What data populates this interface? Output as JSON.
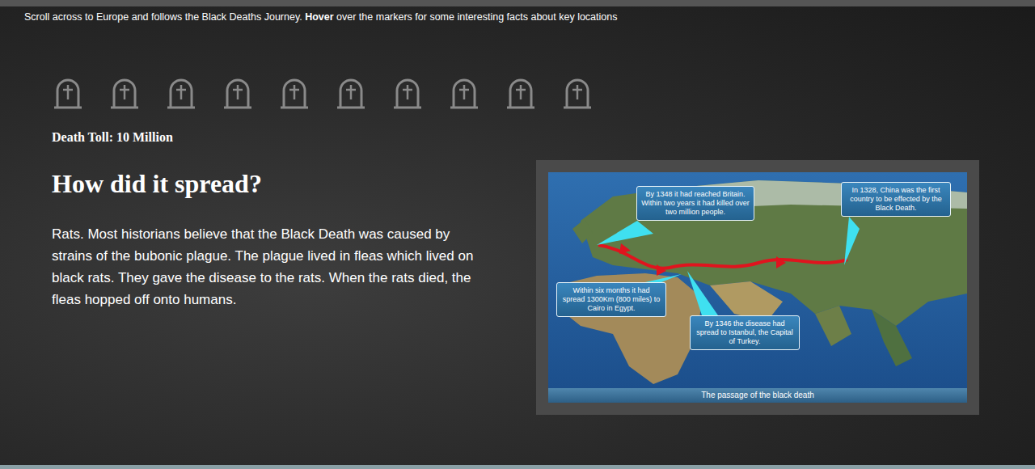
{
  "instruction": {
    "parts": [
      {
        "text": "Scroll across to Europe and follows the Black Deaths Journey. ",
        "bold": false
      },
      {
        "text": "Hover",
        "bold": true
      },
      {
        "text": " over the markers for some interesting facts about key locations",
        "bold": false
      }
    ]
  },
  "gravestone_count": 10,
  "death_toll": "Death Toll: 10 Million",
  "heading": "How did it spread?",
  "body": "Rats. Most historians believe that the Black Death was caused by strains of the bubonic plague. The plague lived in fleas which lived on black rats. They gave the disease to the rats. When the rats died, the fleas hopped off onto humans.",
  "map": {
    "callouts": [
      {
        "text": "By 1348 it had reached Britain. Within two years it had killed over two million people."
      },
      {
        "text": "In 1328, China was the first country to be effected by the Black Death."
      },
      {
        "text": "Within six months it had spread 1300Km (800 miles) to Cairo in Egypt."
      },
      {
        "text": "By 1346 the disease had spread to Istanbul, the Capital of Turkey."
      }
    ],
    "caption": "The passage of the black death"
  }
}
